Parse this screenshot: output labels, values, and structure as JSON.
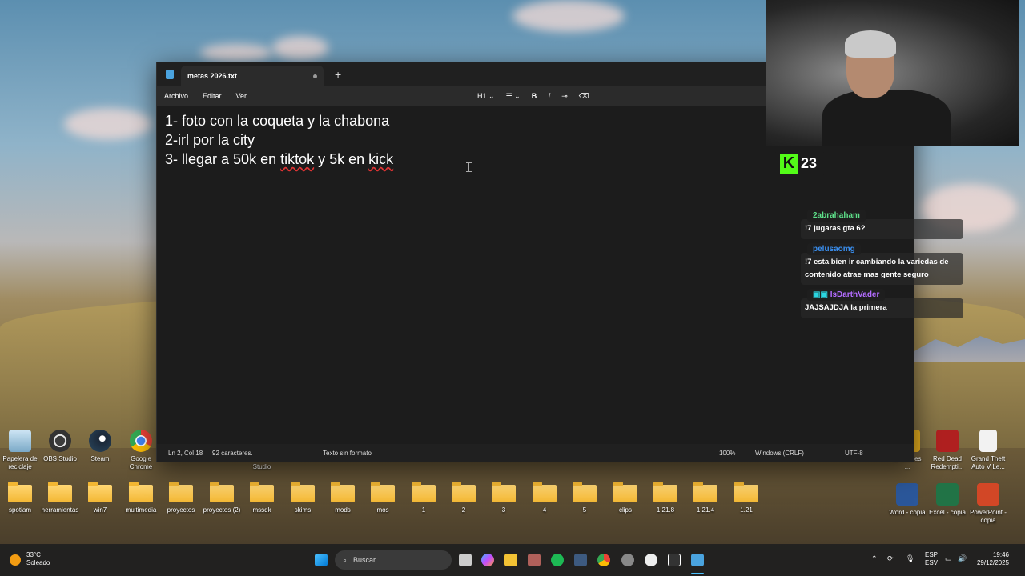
{
  "notepad": {
    "tab_title": "metas 2026.txt",
    "menu": [
      "Archivo",
      "Editar",
      "Ver"
    ],
    "format_heading": "H1",
    "lines": [
      "1- foto con la coqueta y la chabona",
      "2-irl por la city",
      [
        "3- llegar a 50k en ",
        "tiktok",
        " y 5k en ",
        "kick"
      ]
    ],
    "status": {
      "position": "Ln 2, Col 18",
      "chars": "92 caracteres.",
      "format": "Texto sin formato",
      "zoom": "100%",
      "line_ending": "Windows (CRLF)",
      "encoding": "UTF-8"
    }
  },
  "stream": {
    "viewers": "23",
    "kick_color": "#53fc18"
  },
  "chat": [
    {
      "user": "2abrahaham",
      "user_color": "#5ee08a",
      "message": "!7 jugaras gta 6?"
    },
    {
      "user": "pelusaomg",
      "user_color": "#3a8ff0",
      "message": "!7 esta bien ir cambiando la variedas de contenido atrae mas gente seguro"
    },
    {
      "user": "IsDarthVader",
      "user_color": "#b36cff",
      "message": "JAJSAJDJA la primera"
    }
  ],
  "desktop_icons_top": [
    "Papelera de reciclaje",
    "OBS Studio",
    "Steam",
    "Google Chrome"
  ],
  "desktop_stray_label": "Studio",
  "desktop_icons_right": [
    {
      "label": "ar Games ...",
      "color": "#e8b020"
    },
    {
      "label": "Red Dead Redempti...",
      "color": "#b02020"
    },
    {
      "label": "Grand Theft Auto V Le...",
      "color": "#f2f2f2"
    },
    {
      "label": "Word - copia",
      "color": "#2b579a"
    },
    {
      "label": "Excel - copia",
      "color": "#217346"
    },
    {
      "label": "PowerPoint - copia",
      "color": "#d24726"
    }
  ],
  "desktop_folders": [
    "spotiam",
    "herramientas",
    "win7",
    "multimedia",
    "proyectos",
    "proyectos (2)",
    "mssdk",
    "skims",
    "mods",
    "mos",
    "1",
    "2",
    "3",
    "4",
    "5",
    "clips",
    "1.21.8",
    "1.21.4",
    "1.21"
  ],
  "taskbar": {
    "weather_temp": "33°C",
    "weather_desc": "Soleado",
    "search_placeholder": "Buscar",
    "lang_1": "ESP",
    "lang_2": "ESV",
    "time": "19:46",
    "date": "29/12/2025"
  }
}
